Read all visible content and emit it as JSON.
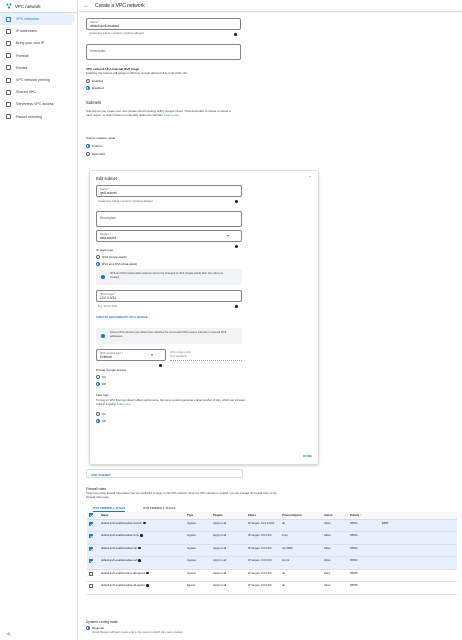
{
  "sidebar": {
    "title": "VPC network",
    "items": [
      {
        "label": "VPC networks",
        "icon": "vpc-network-icon",
        "active": true
      },
      {
        "label": "IP addresses",
        "icon": "ip-address-icon"
      },
      {
        "label": "Bring your own IP",
        "icon": "byoip-icon"
      },
      {
        "label": "Firewall",
        "icon": "firewall-icon"
      },
      {
        "label": "Routes",
        "icon": "routes-icon"
      },
      {
        "label": "VPC network peering",
        "icon": "peering-icon"
      },
      {
        "label": "Shared VPC",
        "icon": "shared-vpc-icon"
      },
      {
        "label": "Serverless VPC access",
        "icon": "serverless-icon"
      },
      {
        "label": "Packet mirroring",
        "icon": "packet-mirroring-icon"
      }
    ],
    "footer": "⊲|"
  },
  "header": {
    "back_icon": "arrow-back-icon",
    "title": "Create a VPC network"
  },
  "form": {
    "name_label": "Name *",
    "name_value": "default-ipv6-enabled",
    "name_hint": "Lowercase letters, numbers, hyphens allowed",
    "description_placeholder": "Description",
    "ula_title": "VPC network ULA internal IPv6 range",
    "ula_help": "Enabling this feature will assign a /48 from Google defined ULA prefix fd20::/20.",
    "ula_options": [
      "Enabled",
      "Disabled"
    ],
    "subnets_title": "Subnets",
    "subnets_desc": "Subnets let you create your own private cloud topology within Google Cloud. Click Automatic to create a subnet in each region, or click Custom to manually define the subnets.",
    "learn_more": "Learn more",
    "creation_mode_label": "Subnet creation mode",
    "creation_modes": [
      "Custom",
      "Automatic"
    ]
  },
  "edit_subnet": {
    "title": "Edit subnet",
    "collapse_icon": "chevron-up-icon",
    "name_label": "Name *",
    "name_value": "ipv6-subnet",
    "name_hint": "Lowercase letters, numbers, hyphens allowed",
    "description_placeholder": "Description",
    "region_label": "Region *",
    "region_value": "asia-south1",
    "stack_label": "IP stack type",
    "stack_options": [
      "IPv4 (single-stack)",
      "IPv4 and IPv6 (dual-stack)"
    ],
    "stack_info": "IPv4 and IPv6 (dual-stack) subnets cannot be changed to IPv4 (single-stack) after the subnet is created.",
    "range_label": "IPv4 range *",
    "range_value": "10.0.0.0/24",
    "range_hint": "E.g. 10.0.0.0/24",
    "secondary_button": "CREATE SECONDARY IPV4 RANGE",
    "access_info": "Subnet IPv6 access type determines whether the connected VMs receive internal or external IPv6 addresses.",
    "access_label": "IPv6 access type *",
    "access_value": "External",
    "prefix_label": "IPv6 range prefix",
    "prefix_value": "N/A (default)",
    "pga_label": "Private Google Access",
    "pga_options": [
      "On",
      "Off"
    ],
    "flow_label": "Flow logs",
    "flow_desc": "Turning on VPC flow logs doesn't affect performance, but some systems generate a large number of logs, which can increase costs in Logging.",
    "flow_learn": "Learn more",
    "flow_options": [
      "On",
      "Off"
    ],
    "done_button": "DONE"
  },
  "add_subnet_button": "ADD SUBNET",
  "firewall": {
    "title": "Firewall rules",
    "desc": "Select any of the firewall rules below that you would like to apply to this VPC network. Once the VPC network is created, you can manage all firewall rules on the Firewall rules page.",
    "tabs": [
      "IPV4 FIREWALL RULES",
      "IPV6 FIREWALL RULES"
    ],
    "columns": [
      "Name",
      "Type",
      "Targets",
      "Filters",
      "Protocols/ports",
      "Action",
      "Priority ↑"
    ],
    "rows": [
      {
        "checked": true,
        "name": "default-ipv6-enabled-allow-custom",
        "type": "Ingress",
        "targets": "Apply to all",
        "filters": "IP ranges: 10.0.0.0/24",
        "ports": "all",
        "action": "Allow",
        "priority": "65534",
        "edit": "EDIT"
      },
      {
        "checked": true,
        "name": "default-ipv6-enabled-allow-icmp",
        "type": "Ingress",
        "targets": "Apply to all",
        "filters": "IP ranges: 0.0.0.0/0",
        "ports": "icmp",
        "action": "Allow",
        "priority": "65534",
        "edit": ""
      },
      {
        "checked": true,
        "name": "default-ipv6-enabled-allow-rdp",
        "type": "Ingress",
        "targets": "Apply to all",
        "filters": "IP ranges: 0.0.0.0/0",
        "ports": "tcp:3389",
        "action": "Allow",
        "priority": "65534",
        "edit": ""
      },
      {
        "checked": true,
        "name": "default-ipv6-enabled-allow-ssh",
        "type": "Ingress",
        "targets": "Apply to all",
        "filters": "IP ranges: 0.0.0.0/0",
        "ports": "tcp:22",
        "action": "Allow",
        "priority": "65534",
        "edit": ""
      },
      {
        "checked": false,
        "name": "default-ipv6-enabled-deny-all-ingress",
        "type": "Ingress",
        "targets": "Apply to all",
        "filters": "IP ranges: 0.0.0.0/0",
        "ports": "all",
        "action": "Deny",
        "priority": "65535",
        "edit": ""
      },
      {
        "checked": false,
        "name": "default-ipv6-enabled-allow-all-egress",
        "type": "Egress",
        "targets": "Apply to all",
        "filters": "IP ranges: 0.0.0.0/0",
        "ports": "all",
        "action": "Allow",
        "priority": "65535",
        "edit": ""
      }
    ]
  },
  "routing": {
    "title": "Dynamic routing mode",
    "option": "Regional",
    "hint": "Cloud Routers will learn routes only in the region in which they were created"
  },
  "colors": {
    "accent": "#1a73e8",
    "selected_row": "#e8f0fe",
    "border": "#dadce0"
  }
}
